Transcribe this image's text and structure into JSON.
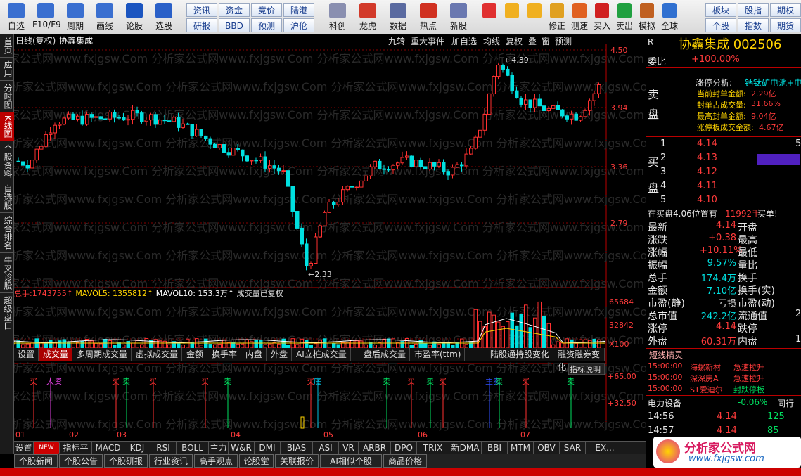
{
  "toolbar": {
    "items": [
      {
        "label": "自选",
        "icon": "star-icon",
        "color": "#3a6fd0"
      },
      {
        "label": "F10/F9",
        "icon": "f10-icon",
        "color": "#3a6fd0"
      },
      {
        "label": "周期",
        "icon": "clock-icon",
        "color": "#3a6fd0"
      },
      {
        "label": "画线",
        "icon": "pen-icon",
        "color": "#3a6fd0"
      },
      {
        "label": "论股",
        "icon": "talk-icon",
        "color": "#1b55c0"
      },
      {
        "label": "选股",
        "icon": "chart-search-icon",
        "color": "#2a60c8"
      }
    ],
    "grid": [
      [
        "资讯",
        "资金",
        "竞价",
        "陆港"
      ],
      [
        "研报",
        "BBD",
        "预测",
        "沪伦"
      ]
    ],
    "items2": [
      {
        "label": "科创",
        "icon": "kechuang-icon",
        "color": "#8a8fb0"
      },
      {
        "label": "龙虎",
        "icon": "dragon-icon",
        "color": "#d23a2a"
      },
      {
        "label": "数据",
        "icon": "pe-icon",
        "color": "#5a6aa0"
      },
      {
        "label": "热点",
        "icon": "hot-icon",
        "color": "#d03020"
      },
      {
        "label": "新股",
        "icon": "ipo-icon",
        "color": "#6a78b0"
      }
    ],
    "items3": [
      {
        "label": "",
        "icon": "color-block-icon",
        "color": "#e03030"
      },
      {
        "label": "",
        "icon": "back-arrow-icon",
        "color": "#f0b020"
      },
      {
        "label": "",
        "icon": "up-down-arrow-icon",
        "color": "#f0b020"
      },
      {
        "label": "修正",
        "icon": "wrench-icon",
        "color": "#e0a020"
      },
      {
        "label": "测速",
        "icon": "stopwatch-icon",
        "color": "#e06020"
      },
      {
        "label": "买入",
        "icon": "buy-icon",
        "color": "#d02020"
      },
      {
        "label": "卖出",
        "icon": "sell-icon",
        "color": "#20a040"
      },
      {
        "label": "模拟",
        "icon": "hammer-icon",
        "color": "#c06020"
      },
      {
        "label": "全球",
        "icon": "globe-icon",
        "color": "#3070d0"
      }
    ],
    "grid2": [
      [
        "板块",
        "股指",
        "期权"
      ],
      [
        "个股",
        "指数",
        "期货"
      ]
    ]
  },
  "leftnav": [
    "首页",
    "应用",
    "分时图",
    "K线图",
    "个股资料",
    "自选股",
    "综合排名",
    "牛叉诊股",
    "超级盘口"
  ],
  "chart": {
    "title_left": "日线(复权)",
    "stock_name": "协鑫集成",
    "menu": [
      "九转",
      "重大事件",
      "加自选",
      "均线",
      "复权",
      "叠",
      "窗",
      "预测"
    ],
    "price_axis": [
      "4.50",
      "3.94",
      "3.36",
      "2.79"
    ],
    "vol_axis": [
      "65684",
      "32842",
      "X100"
    ],
    "ind_axis": [
      "+65.00",
      "+32.50"
    ],
    "high_label": "4.39",
    "low_label": "2.33",
    "vol_legend": {
      "zongshou_label": "总手:",
      "zongshou": "1743755",
      "ma5_label": "MAVOL5:",
      "ma5": "1355812",
      "ma10_label": "MAVOL10:",
      "ma10": "153.3万",
      "note": "成交量已复权"
    },
    "months": [
      "01",
      "02",
      "03",
      "04",
      "05",
      "06",
      "07"
    ],
    "signals": [
      {
        "label": "买",
        "color": "#ff3030"
      },
      {
        "label": "卖",
        "color": "#00e060"
      },
      {
        "label": "大资",
        "color": "#e040e0"
      },
      {
        "label": "底",
        "color": "#00c0e0"
      },
      {
        "label": "主卖",
        "color": "#3050ff"
      }
    ],
    "indicator_note": "指标说明",
    "watermark": "分析家公式网www.fxjgsw.Com",
    "colors": {
      "up": "#ff3030",
      "down": "#00e0e0",
      "ma5": "#ffffff",
      "ma10": "#ffd400",
      "grid": "#8a0000"
    }
  },
  "vol_tabs": [
    "设置",
    "成交量",
    "多周期成交量",
    "虚拟成交量",
    "金额",
    "换手率",
    "内盘",
    "外盘",
    "AI立桩成交量",
    "盘后成交量",
    "市盈率(ttm)",
    "陆股通持股变化",
    "融资融券变化"
  ],
  "bottom_tabs": [
    "设置",
    "NEW",
    "指标平台",
    "MACD",
    "KDJ",
    "RSI",
    "BOLL",
    "主力",
    "W&R",
    "DMI",
    "BIAS",
    "ASI",
    "VR",
    "ARBR",
    "DPO",
    "TRIX",
    "新DMA",
    "BBI",
    "MTM",
    "OBV",
    "SAR",
    "EX..."
  ],
  "news_tabs": [
    "个股新闻",
    "个股公告",
    "个股研报",
    "行业资讯",
    "高手观点",
    "论股堂",
    "关联报价",
    "AI相似个股",
    "商品价格"
  ],
  "right": {
    "code_prefix": "R",
    "title": "协鑫集成 002506",
    "weibi_label": "委比",
    "weibi": "+100.00%",
    "sell_label": [
      "卖",
      "盘"
    ],
    "analysis_label": "涨停分析:",
    "analysis_tags": "钙钛矿电池+电电",
    "analysis_rows": [
      [
        "当前封单金额:",
        "2.29亿"
      ],
      [
        "封单占成交量:",
        "31.66%"
      ],
      [
        "最高封单金额:",
        "9.04亿"
      ],
      [
        "涨停板成交金额:",
        "4.67亿"
      ]
    ],
    "buy_label": [
      "买",
      "盘"
    ],
    "bids": [
      [
        "1",
        "4.14",
        "5"
      ],
      [
        "2",
        "4.13",
        ""
      ],
      [
        "3",
        "4.12",
        ""
      ],
      [
        "4",
        "4.11",
        ""
      ],
      [
        "5",
        "4.10",
        ""
      ]
    ],
    "bid_note_a": "在买盘4.06位置有",
    "bid_note_b": "11992手",
    "bid_note_c": "买单!",
    "quote": [
      [
        "最新",
        "4.14",
        "开盘",
        ""
      ],
      [
        "涨跌",
        "+0.38",
        "最高",
        ""
      ],
      [
        "涨幅",
        "+10.11%",
        "最低",
        ""
      ],
      [
        "振幅",
        "9.57%",
        "量比",
        ""
      ],
      [
        "总手",
        "174.4万",
        "换手",
        ""
      ],
      [
        "金额",
        "7.10亿",
        "换手(实)",
        ""
      ],
      [
        "市盈(静)",
        "亏损",
        "市盈(动)",
        ""
      ],
      [
        "总市值",
        "242.2亿",
        "流通值",
        "2"
      ],
      [
        "涨停",
        "4.14",
        "跌停",
        ""
      ],
      [
        "外盘",
        "60.31万",
        "内盘",
        "1"
      ]
    ],
    "sprite_title": "短线精灵",
    "sprite": [
      [
        "15:00:00",
        "海螺新材",
        "急速拉升"
      ],
      [
        "15:00:00",
        "深深房A",
        "急速拉升"
      ],
      [
        "15:00:00",
        "ST爱迪尔",
        "封跌停板"
      ]
    ],
    "sector": "电力设备",
    "sector_chg": "-0.06%",
    "sector_tab": "同行",
    "ticks": [
      [
        "14:56",
        "4.14",
        "125"
      ],
      [
        "14:57",
        "4.14",
        "85"
      ]
    ],
    "logo_text": "分析家公式网",
    "logo_url": "www.fxjgsw.com"
  }
}
